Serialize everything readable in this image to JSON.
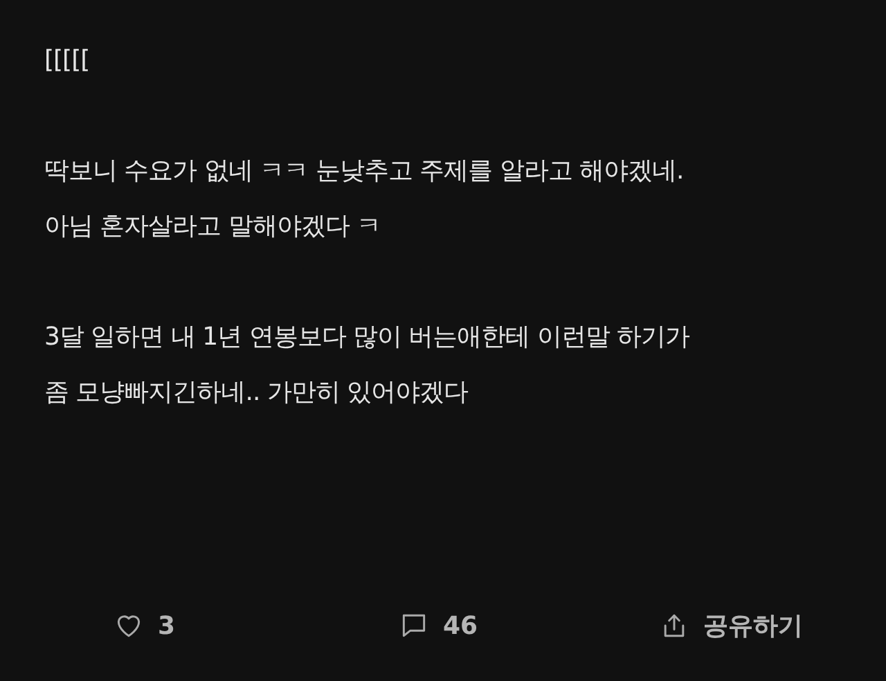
{
  "post": {
    "paragraphs": [
      [
        "[[[[["
      ],
      [
        "딱보니 수요가 없네 ㅋㅋ 눈낮추고 주제를 알라고 해야겠네.",
        "아님 혼자살라고 말해야겠다 ㅋ"
      ],
      [
        "3달 일하면 내 1년 연봉보다 많이 버는애한테 이런말 하기가",
        "좀 모냥빠지긴하네.. 가만히 있어야겠다"
      ]
    ]
  },
  "actions": [
    {
      "kind": "like",
      "label": "3"
    },
    {
      "kind": "comment",
      "label": "46"
    },
    {
      "kind": "share",
      "label": "공유하기"
    }
  ]
}
